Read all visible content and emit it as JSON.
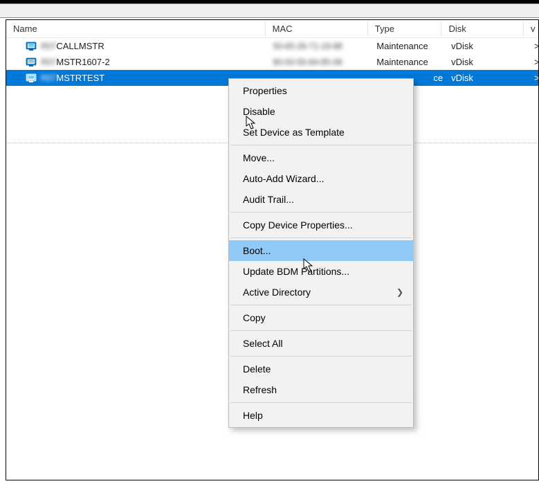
{
  "header": {
    "name": "Name",
    "mac": "MAC",
    "type": "Type",
    "disk": "Disk",
    "extra": "v"
  },
  "rows": [
    {
      "name": "CALLMSTR",
      "prefix": "R07",
      "mac": "50-65-26-71-19-88",
      "type": "Maintenance",
      "disk": "vDisk",
      "x": ">"
    },
    {
      "name": "MSTR1607-2",
      "prefix": "R07",
      "mac": "80-50-50-84-85-08",
      "type": "Maintenance",
      "disk": "vDisk",
      "x": ">"
    },
    {
      "name": "MSTRTEST",
      "prefix": "R07",
      "mac": "",
      "type_suffix": "ce",
      "disk": "vDisk",
      "x": ">"
    }
  ],
  "menu": {
    "properties": "Properties",
    "disable": "Disable",
    "setTemplate": "Set Device as Template",
    "move": "Move...",
    "autoAdd": "Auto-Add Wizard...",
    "auditTrail": "Audit Trail...",
    "copyProps": "Copy Device Properties...",
    "boot": "Boot...",
    "updateBdm": "Update BDM Partitions...",
    "activeDirectory": "Active Directory",
    "copy": "Copy",
    "selectAll": "Select All",
    "delete": "Delete",
    "refresh": "Refresh",
    "help": "Help"
  }
}
